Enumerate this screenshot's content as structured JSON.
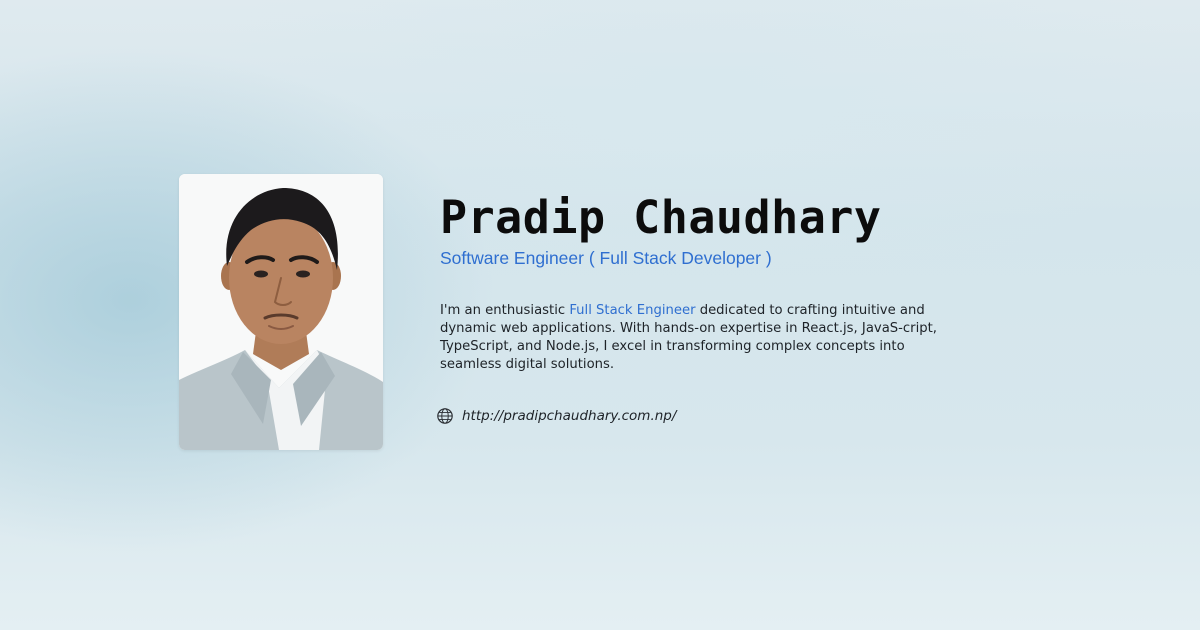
{
  "profile": {
    "name": "Pradip Chaudhary",
    "role": "Software Engineer ( Full Stack Developer )",
    "bio": {
      "before": "I'm an enthusiastic ",
      "highlight": "Full Stack Engineer",
      "after": " dedicated to crafting intuitive and dynamic web applications. With hands-on expertise in React.js, JavaS-cript, TypeScript, and Node.js, I excel in transforming complex concepts into seamless digital solutions."
    },
    "website": {
      "icon": "globe-icon",
      "url": "http://pradipchaudhary.com.np/"
    },
    "photo": {
      "icon": "portrait-photo"
    }
  },
  "colors": {
    "accent": "#2f6fd0",
    "text": "#1e2328",
    "heading": "#0c0c0c",
    "background": "#d7e7ed"
  }
}
